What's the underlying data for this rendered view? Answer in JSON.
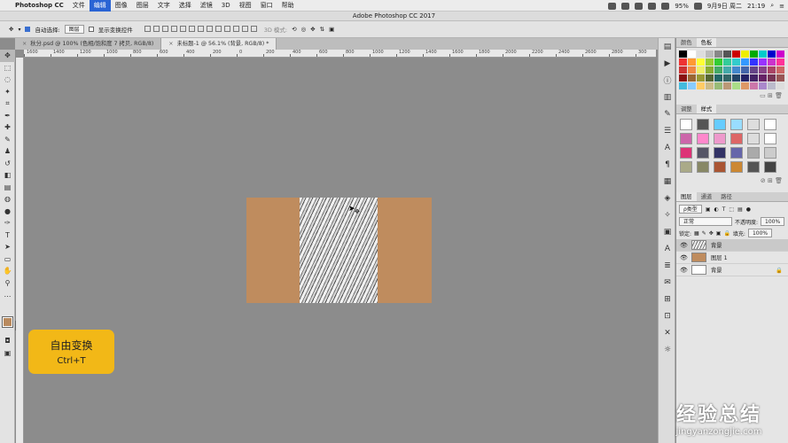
{
  "menubar": {
    "app": "Photoshop CC",
    "items": [
      "文件",
      "编辑",
      "图像",
      "图层",
      "文字",
      "选择",
      "滤镜",
      "3D",
      "视图",
      "窗口",
      "帮助"
    ],
    "selected": "编辑",
    "battery": "95%",
    "date": "9月9日 周二",
    "time": "21:19"
  },
  "window": {
    "title": "Adobe Photoshop CC 2017"
  },
  "options": {
    "auto_select_label": "自动选择:",
    "auto_select_value": "图层",
    "show_transform_label": "显示变换控件",
    "mode_3d": "3D 模式:"
  },
  "tabs": [
    {
      "label": "秋分.psd @ 100% (色相/饱和度 7 拷贝, RGB/8)"
    },
    {
      "label": "未标题-1 @ 56.1% (背景, RGB/8) *"
    }
  ],
  "ruler": {
    "ticks": [
      "1600",
      "1400",
      "1200",
      "1000",
      "800",
      "600",
      "400",
      "200",
      "0",
      "200",
      "400",
      "600",
      "800",
      "1000",
      "1200",
      "1400",
      "1600",
      "1800",
      "2000",
      "2200",
      "2400",
      "2600",
      "2800",
      "300"
    ]
  },
  "tooltip": {
    "title": "自由变换",
    "shortcut": "Ctrl+T"
  },
  "panels": {
    "color_tabs": [
      "颜色",
      "色板"
    ],
    "adjust_tabs": [
      "调整",
      "样式"
    ],
    "layer_tabs": [
      "图层",
      "通道",
      "路径"
    ],
    "kind_label": "ρ类型",
    "blend_mode": "正常",
    "opacity_label": "不透明度:",
    "opacity": "100%",
    "lock_label": "锁定:",
    "fill_label": "填充:",
    "fill": "100%",
    "layers": [
      {
        "name": "背景",
        "selected": true
      },
      {
        "name": "图层 1",
        "selected": false
      },
      {
        "name": "背景",
        "selected": false
      }
    ]
  },
  "canvas_colors": {
    "bg": "#8c8c8c",
    "side": "#bf8c5e"
  },
  "watermark": {
    "brand": "经验总结",
    "url": "jingyanzongjie.com"
  }
}
